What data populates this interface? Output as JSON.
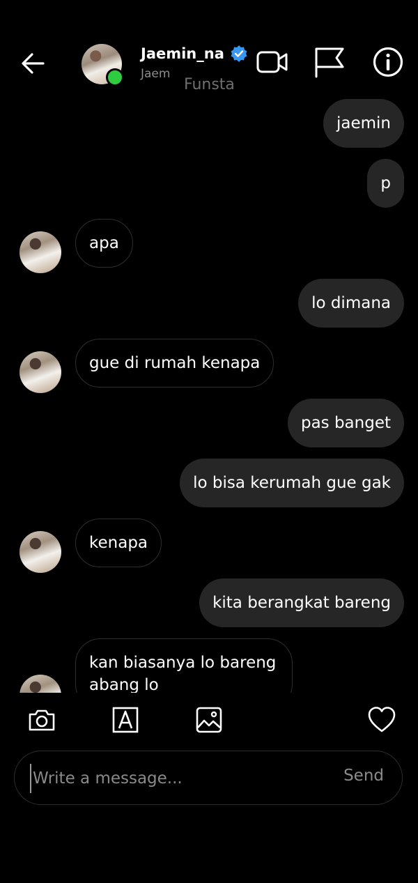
{
  "header": {
    "username": "Jaemin_na",
    "subname": "Jaem",
    "tag": "Funsta"
  },
  "messages": [
    {
      "side": "sent",
      "text": "jaemin"
    },
    {
      "side": "sent",
      "text": "p"
    },
    {
      "side": "received",
      "text": "apa"
    },
    {
      "side": "sent",
      "text": "lo dimana"
    },
    {
      "side": "received",
      "text": "gue di rumah kenapa"
    },
    {
      "side": "sent",
      "text": "pas banget"
    },
    {
      "side": "sent",
      "text": "lo bisa kerumah gue gak"
    },
    {
      "side": "received",
      "text": "kenapa"
    },
    {
      "side": "sent",
      "text": "kita berangkat bareng"
    },
    {
      "side": "received",
      "text": "kan biasanya lo bareng abang lo"
    }
  ],
  "composer": {
    "placeholder": "Write a message...",
    "send_label": "Send"
  },
  "colors": {
    "background": "#000000",
    "sent_bubble": "#262626",
    "online": "#2ecc40",
    "verified": "#3897f0"
  }
}
